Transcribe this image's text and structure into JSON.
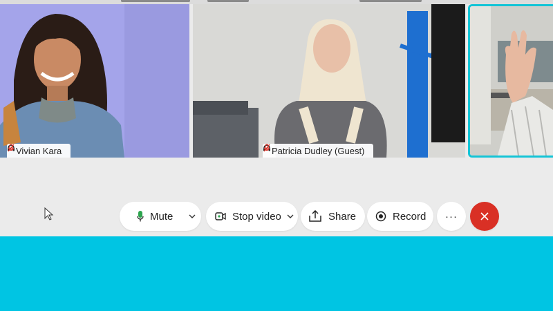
{
  "participants": [
    {
      "name": "Vivian Kara",
      "muted": true,
      "icon": "headset-icon"
    },
    {
      "name": "Patricia Dudley (Guest)",
      "muted": true,
      "icon": "headset-icon"
    },
    {
      "name": "",
      "active_speaker": true
    }
  ],
  "controls": {
    "mute_label": "Mute",
    "stop_video_label": "Stop video",
    "share_label": "Share",
    "record_label": "Record",
    "more_label": "···",
    "end_icon": "close-icon"
  },
  "colors": {
    "active_speaker_border": "#13c4d6",
    "end_call": "#d93025",
    "mic_active": "#2da44e",
    "mic_muted": "#d93025",
    "bottom_band": "#00c5e3"
  }
}
